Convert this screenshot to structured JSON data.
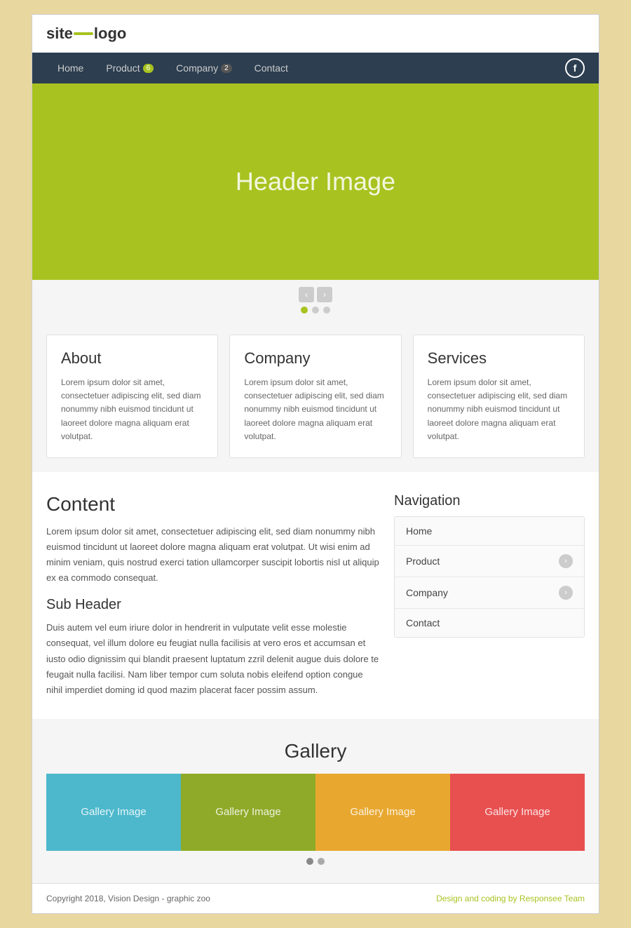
{
  "logo": {
    "site": "site",
    "logo": "logo"
  },
  "nav": {
    "items": [
      {
        "label": "Home",
        "badge": null
      },
      {
        "label": "Product",
        "badge": "6"
      },
      {
        "label": "Company",
        "badge": "2"
      },
      {
        "label": "Contact",
        "badge": null
      }
    ],
    "facebook_label": "f"
  },
  "hero": {
    "title": "Header Image"
  },
  "slider": {
    "prev": "‹",
    "next": "›",
    "dots": [
      true,
      false,
      false
    ]
  },
  "cards": [
    {
      "title": "About",
      "text": "Lorem ipsum dolor sit amet, consectetuer adipiscing elit, sed diam nonummy nibh euismod tincidunt ut laoreet dolore magna aliquam erat volutpat."
    },
    {
      "title": "Company",
      "text": "Lorem ipsum dolor sit amet, consectetuer adipiscing elit, sed diam nonummy nibh euismod tincidunt ut laoreet dolore magna aliquam erat volutpat."
    },
    {
      "title": "Services",
      "text": "Lorem ipsum dolor sit amet, consectetuer adipiscing elit, sed diam nonummy nibh euismod tincidunt ut laoreet dolore magna aliquam erat volutpat."
    }
  ],
  "content": {
    "title": "Content",
    "main_text": "Lorem ipsum dolor sit amet, consectetuer adipiscing elit, sed diam nonummy nibh euismod tincidunt ut laoreet dolore magna aliquam erat volutpat. Ut wisi enim ad minim veniam, quis nostrud exerci tation ullamcorper suscipit lobortis nisl ut aliquip ex ea commodo consequat.",
    "sub_header": "Sub Header",
    "sub_text": "Duis autem vel eum iriure dolor in hendrerit in vulputate velit esse molestie consequat, vel illum dolore eu feugiat nulla facilisis at vero eros et accumsan et iusto odio dignissim qui blandit praesent luptatum zzril delenit augue duis dolore te feugait nulla facilisi. Nam liber tempor cum soluta nobis eleifend option congue nihil imperdiet doming id quod mazim placerat facer possim assum."
  },
  "sidebar_nav": {
    "title": "Navigation",
    "items": [
      {
        "label": "Home",
        "has_arrow": false
      },
      {
        "label": "Product",
        "has_arrow": true
      },
      {
        "label": "Company",
        "has_arrow": true
      },
      {
        "label": "Contact",
        "has_arrow": false
      }
    ],
    "arrow": "›"
  },
  "gallery": {
    "title": "Gallery",
    "items": [
      {
        "label": "Gallery Image",
        "color_class": "blue"
      },
      {
        "label": "Gallery Image",
        "color_class": "green"
      },
      {
        "label": "Gallery Image",
        "color_class": "orange"
      },
      {
        "label": "Gallery Image",
        "color_class": "red"
      }
    ],
    "dots": [
      true,
      false
    ]
  },
  "footer": {
    "copyright": "Copyright 2018, Vision Design - graphic zoo",
    "credit": "Design and coding by Responsee Team"
  }
}
